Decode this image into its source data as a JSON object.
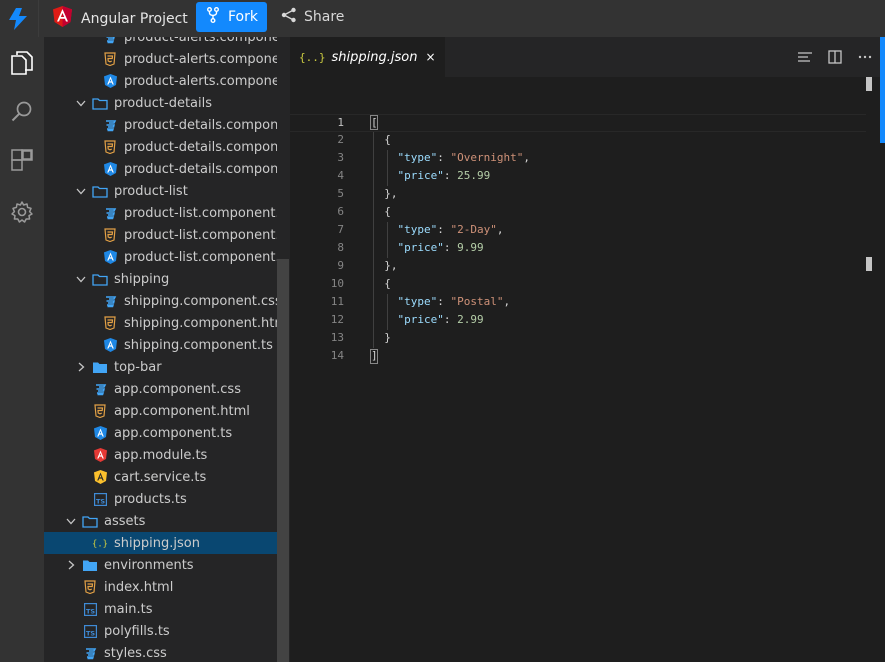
{
  "header": {
    "project_title": "Angular Project",
    "fork_label": "Fork",
    "share_label": "Share"
  },
  "tree": [
    {
      "label": "product-alerts.componen...",
      "icon": "css-file-icon",
      "depth": 3,
      "chevron": ""
    },
    {
      "label": "product-alerts.compone...",
      "icon": "html-file-icon",
      "depth": 3,
      "chevron": ""
    },
    {
      "label": "product-alerts.compone...",
      "icon": "angular-ts-file-icon",
      "depth": 3,
      "chevron": ""
    },
    {
      "label": "product-details",
      "icon": "folder-open-icon",
      "depth": 2,
      "chevron": "down"
    },
    {
      "label": "product-details.compon...",
      "icon": "css-file-icon",
      "depth": 3,
      "chevron": ""
    },
    {
      "label": "product-details.compon...",
      "icon": "html-file-icon",
      "depth": 3,
      "chevron": ""
    },
    {
      "label": "product-details.compon...",
      "icon": "angular-ts-file-icon",
      "depth": 3,
      "chevron": ""
    },
    {
      "label": "product-list",
      "icon": "folder-open-icon",
      "depth": 2,
      "chevron": "down"
    },
    {
      "label": "product-list.component....",
      "icon": "css-file-icon",
      "depth": 3,
      "chevron": ""
    },
    {
      "label": "product-list.component....",
      "icon": "html-file-icon",
      "depth": 3,
      "chevron": ""
    },
    {
      "label": "product-list.component.ts",
      "icon": "angular-ts-file-icon",
      "depth": 3,
      "chevron": ""
    },
    {
      "label": "shipping",
      "icon": "folder-open-icon",
      "depth": 2,
      "chevron": "down"
    },
    {
      "label": "shipping.component.css",
      "icon": "css-file-icon",
      "depth": 3,
      "chevron": ""
    },
    {
      "label": "shipping.component.html",
      "icon": "html-file-icon",
      "depth": 3,
      "chevron": ""
    },
    {
      "label": "shipping.component.ts",
      "icon": "angular-ts-file-icon",
      "depth": 3,
      "chevron": ""
    },
    {
      "label": "top-bar",
      "icon": "folder-closed-icon",
      "depth": 2,
      "chevron": "right"
    },
    {
      "label": "app.component.css",
      "icon": "css-file-icon",
      "depth": 2,
      "chevron": ""
    },
    {
      "label": "app.component.html",
      "icon": "html-file-icon",
      "depth": 2,
      "chevron": ""
    },
    {
      "label": "app.component.ts",
      "icon": "angular-ts-file-icon",
      "depth": 2,
      "chevron": ""
    },
    {
      "label": "app.module.ts",
      "icon": "angular-module-icon",
      "depth": 2,
      "chevron": ""
    },
    {
      "label": "cart.service.ts",
      "icon": "angular-service-icon",
      "depth": 2,
      "chevron": ""
    },
    {
      "label": "products.ts",
      "icon": "ts-file-icon",
      "depth": 2,
      "chevron": ""
    },
    {
      "label": "assets",
      "icon": "folder-open-icon",
      "depth": 1,
      "chevron": "down"
    },
    {
      "label": "shipping.json",
      "icon": "json-file-icon",
      "depth": 2,
      "chevron": "",
      "selected": true
    },
    {
      "label": "environments",
      "icon": "folder-closed-icon",
      "depth": 1,
      "chevron": "right"
    },
    {
      "label": "index.html",
      "icon": "html-file-icon",
      "depth": 1,
      "chevron": ""
    },
    {
      "label": "main.ts",
      "icon": "ts-file-icon",
      "depth": 1,
      "chevron": ""
    },
    {
      "label": "polyfills.ts",
      "icon": "ts-file-icon",
      "depth": 1,
      "chevron": ""
    },
    {
      "label": "styles.css",
      "icon": "css-file-icon",
      "depth": 1,
      "chevron": ""
    }
  ],
  "editor": {
    "tab_label": "shipping.json",
    "tab_icon_text": "{..}",
    "tab_close": "×",
    "lines": [
      {
        "n": "1",
        "parts": [
          [
            "p",
            "["
          ]
        ]
      },
      {
        "n": "2",
        "parts": [
          [
            "p",
            "  {"
          ]
        ]
      },
      {
        "n": "3",
        "parts": [
          [
            "p",
            "    "
          ],
          [
            "k",
            "\"type\""
          ],
          [
            "p",
            ": "
          ],
          [
            "s",
            "\"Overnight\""
          ],
          [
            "p",
            ","
          ]
        ]
      },
      {
        "n": "4",
        "parts": [
          [
            "p",
            "    "
          ],
          [
            "k",
            "\"price\""
          ],
          [
            "p",
            ": "
          ],
          [
            "n",
            "25.99"
          ]
        ]
      },
      {
        "n": "5",
        "parts": [
          [
            "p",
            "  },"
          ]
        ]
      },
      {
        "n": "6",
        "parts": [
          [
            "p",
            "  {"
          ]
        ]
      },
      {
        "n": "7",
        "parts": [
          [
            "p",
            "    "
          ],
          [
            "k",
            "\"type\""
          ],
          [
            "p",
            ": "
          ],
          [
            "s",
            "\"2-Day\""
          ],
          [
            "p",
            ","
          ]
        ]
      },
      {
        "n": "8",
        "parts": [
          [
            "p",
            "    "
          ],
          [
            "k",
            "\"price\""
          ],
          [
            "p",
            ": "
          ],
          [
            "n",
            "9.99"
          ]
        ]
      },
      {
        "n": "9",
        "parts": [
          [
            "p",
            "  },"
          ]
        ]
      },
      {
        "n": "10",
        "parts": [
          [
            "p",
            "  {"
          ]
        ]
      },
      {
        "n": "11",
        "parts": [
          [
            "p",
            "    "
          ],
          [
            "k",
            "\"type\""
          ],
          [
            "p",
            ": "
          ],
          [
            "s",
            "\"Postal\""
          ],
          [
            "p",
            ","
          ]
        ]
      },
      {
        "n": "12",
        "parts": [
          [
            "p",
            "    "
          ],
          [
            "k",
            "\"price\""
          ],
          [
            "p",
            ": "
          ],
          [
            "n",
            "2.99"
          ]
        ]
      },
      {
        "n": "13",
        "parts": [
          [
            "p",
            "  }"
          ]
        ]
      },
      {
        "n": "14",
        "parts": [
          [
            "p",
            "]"
          ]
        ]
      }
    ]
  },
  "colors": {
    "accent": "#1389fd",
    "selection": "#094771",
    "json_key": "#9cdcfe",
    "json_string": "#ce9178",
    "json_number": "#b5cea8"
  }
}
